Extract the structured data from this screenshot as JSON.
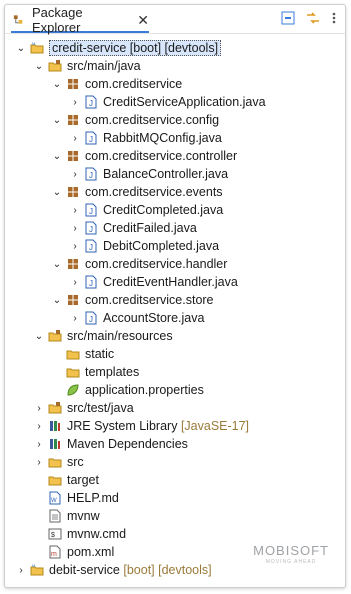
{
  "view": {
    "tab_title": "Package Explorer",
    "close_glyph": "✕"
  },
  "tree": {
    "project": "credit-service [boot] [devtools]",
    "src_main_java": "src/main/java",
    "pkg1": "com.creditservice",
    "pkg1_file1": "CreditServiceApplication.java",
    "pkg2": "com.creditservice.config",
    "pkg2_file1": "RabbitMQConfig.java",
    "pkg3": "com.creditservice.controller",
    "pkg3_file1": "BalanceController.java",
    "pkg4": "com.creditservice.events",
    "pkg4_file1": "CreditCompleted.java",
    "pkg4_file2": "CreditFailed.java",
    "pkg4_file3": "DebitCompleted.java",
    "pkg5": "com.creditservice.handler",
    "pkg5_file1": "CreditEventHandler.java",
    "pkg6": "com.creditservice.store",
    "pkg6_file1": "AccountStore.java",
    "src_main_resources": "src/main/resources",
    "res_static": "static",
    "res_templates": "templates",
    "res_props": "application.properties",
    "src_test_java": "src/test/java",
    "jre_label": "JRE System Library",
    "jre_suffix": "[JavaSE-17]",
    "maven": "Maven Dependencies",
    "src": "src",
    "target": "target",
    "help": "HELP.md",
    "mvnw": "mvnw",
    "mvnw_cmd": "mvnw.cmd",
    "pom": "pom.xml",
    "project2": "debit-service",
    "project2_suffix": "[boot] [devtools]"
  },
  "logo": {
    "text": "MOBISOFT",
    "tag": "MOVING AHEAD"
  },
  "colors": {
    "accent": "#3b7bd8",
    "package": "#a86a2b",
    "folder": "#e7b53b",
    "java": "#2f63b6"
  }
}
